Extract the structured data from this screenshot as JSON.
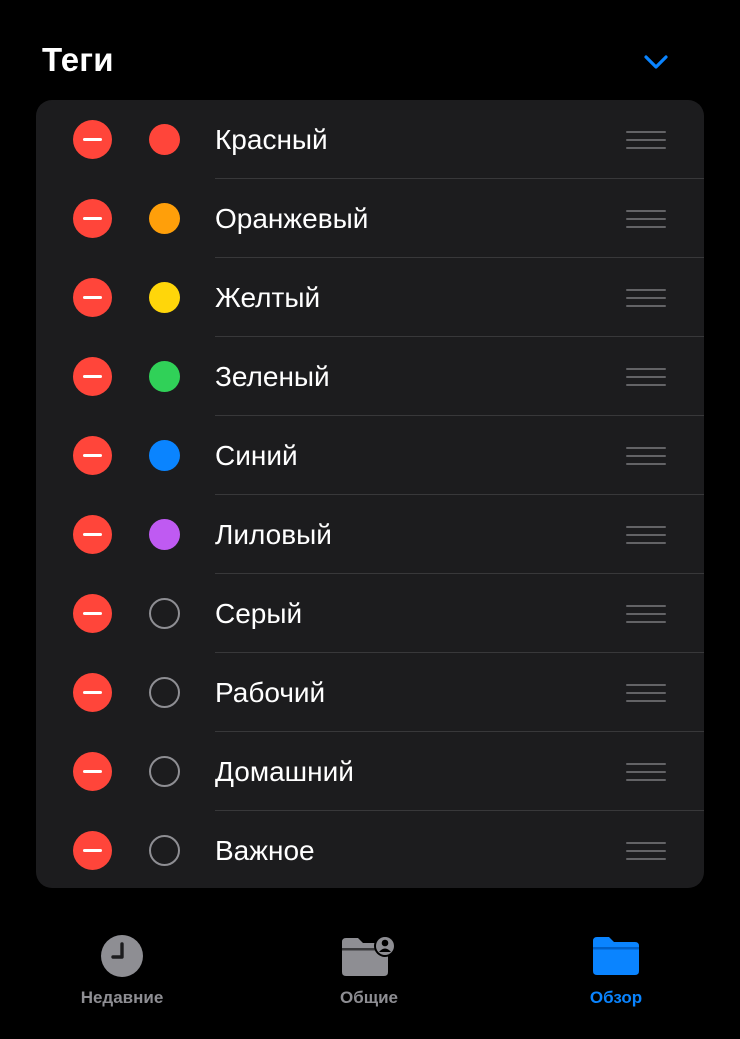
{
  "header": {
    "title": "Теги",
    "chevron_icon": "chevron-down-icon",
    "accent_color": "#0a84ff"
  },
  "tags": [
    {
      "label": "Красный",
      "color": "#ff453a",
      "filled": true
    },
    {
      "label": "Оранжевый",
      "color": "#ff9f0a",
      "filled": true
    },
    {
      "label": "Желтый",
      "color": "#ffd60a",
      "filled": true
    },
    {
      "label": "Зеленый",
      "color": "#30d158",
      "filled": true
    },
    {
      "label": "Синий",
      "color": "#0a84ff",
      "filled": true
    },
    {
      "label": "Лиловый",
      "color": "#bf5af2",
      "filled": true
    },
    {
      "label": "Серый",
      "color": "#8e8e93",
      "filled": false
    },
    {
      "label": "Рабочий",
      "color": "#8e8e93",
      "filled": false
    },
    {
      "label": "Домашний",
      "color": "#8e8e93",
      "filled": false
    },
    {
      "label": "Важное",
      "color": "#8e8e93",
      "filled": false
    }
  ],
  "row_icons": {
    "delete": "minus-circle-icon",
    "reorder": "drag-handle-icon"
  },
  "tab_bar": {
    "tabs": [
      {
        "label": "Недавние",
        "icon": "clock-icon",
        "active": false
      },
      {
        "label": "Общие",
        "icon": "shared-folder-icon",
        "active": false
      },
      {
        "label": "Обзор",
        "icon": "folder-icon",
        "active": true
      }
    ],
    "active_color": "#0a84ff",
    "inactive_color": "#8e8e93"
  }
}
